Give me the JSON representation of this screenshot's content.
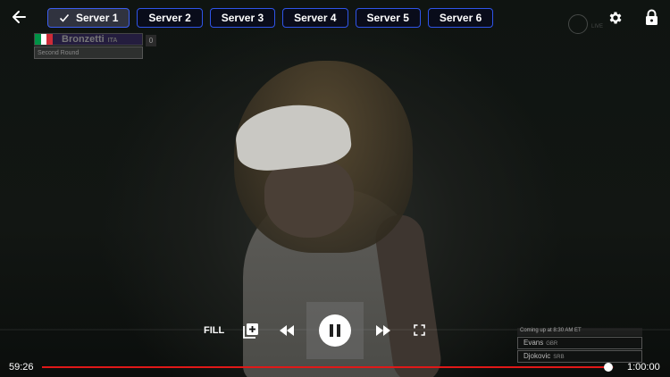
{
  "servers": [
    {
      "label": "Server 1",
      "selected": true
    },
    {
      "label": "Server 2",
      "selected": false
    },
    {
      "label": "Server 3",
      "selected": false
    },
    {
      "label": "Server 4",
      "selected": false
    },
    {
      "label": "Server 5",
      "selected": false
    },
    {
      "label": "Server 6",
      "selected": false
    }
  ],
  "icons": {
    "back": "arrow-left-icon",
    "settings": "gear-icon",
    "lock": "lock-icon",
    "add_queue": "add-to-queue-icon",
    "rewind": "rewind-icon",
    "forward": "fast-forward-icon",
    "fullscreen": "fullscreen-icon",
    "pause": "pause-icon"
  },
  "scoreboard": {
    "player": "Bronzetti",
    "country": "ITA",
    "score": "0",
    "round": "Second Round",
    "flag_colors": [
      "#009246",
      "#ffffff",
      "#ce2b37"
    ]
  },
  "watermark": {
    "text": "LIVE"
  },
  "controls": {
    "fill_label": "FILL"
  },
  "coming_up": {
    "heading": "Coming up at 8:30 AM ET",
    "players": [
      {
        "name": "Evans",
        "country": "GBR"
      },
      {
        "name": "Djokovic",
        "country": "SRB"
      }
    ]
  },
  "playback": {
    "elapsed": "59:26",
    "duration": "1:00:00",
    "progress": 0.991
  },
  "colors": {
    "accent_blue": "#2f54e8",
    "progress_red": "#e01818"
  }
}
